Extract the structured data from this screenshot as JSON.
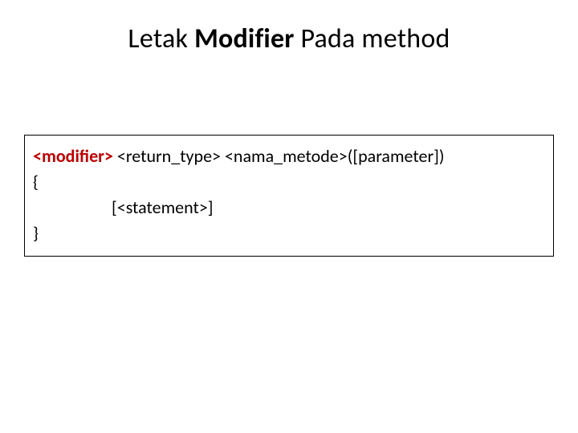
{
  "title": {
    "part1": "Letak ",
    "part2": "Modifier",
    "part3": " Pada method"
  },
  "syntax": {
    "modifier": "<modifier>",
    "rest": " <return_type> <nama_metode>([parameter])",
    "open_brace": "{",
    "statement": "[<statement>]",
    "close_brace": "}"
  }
}
